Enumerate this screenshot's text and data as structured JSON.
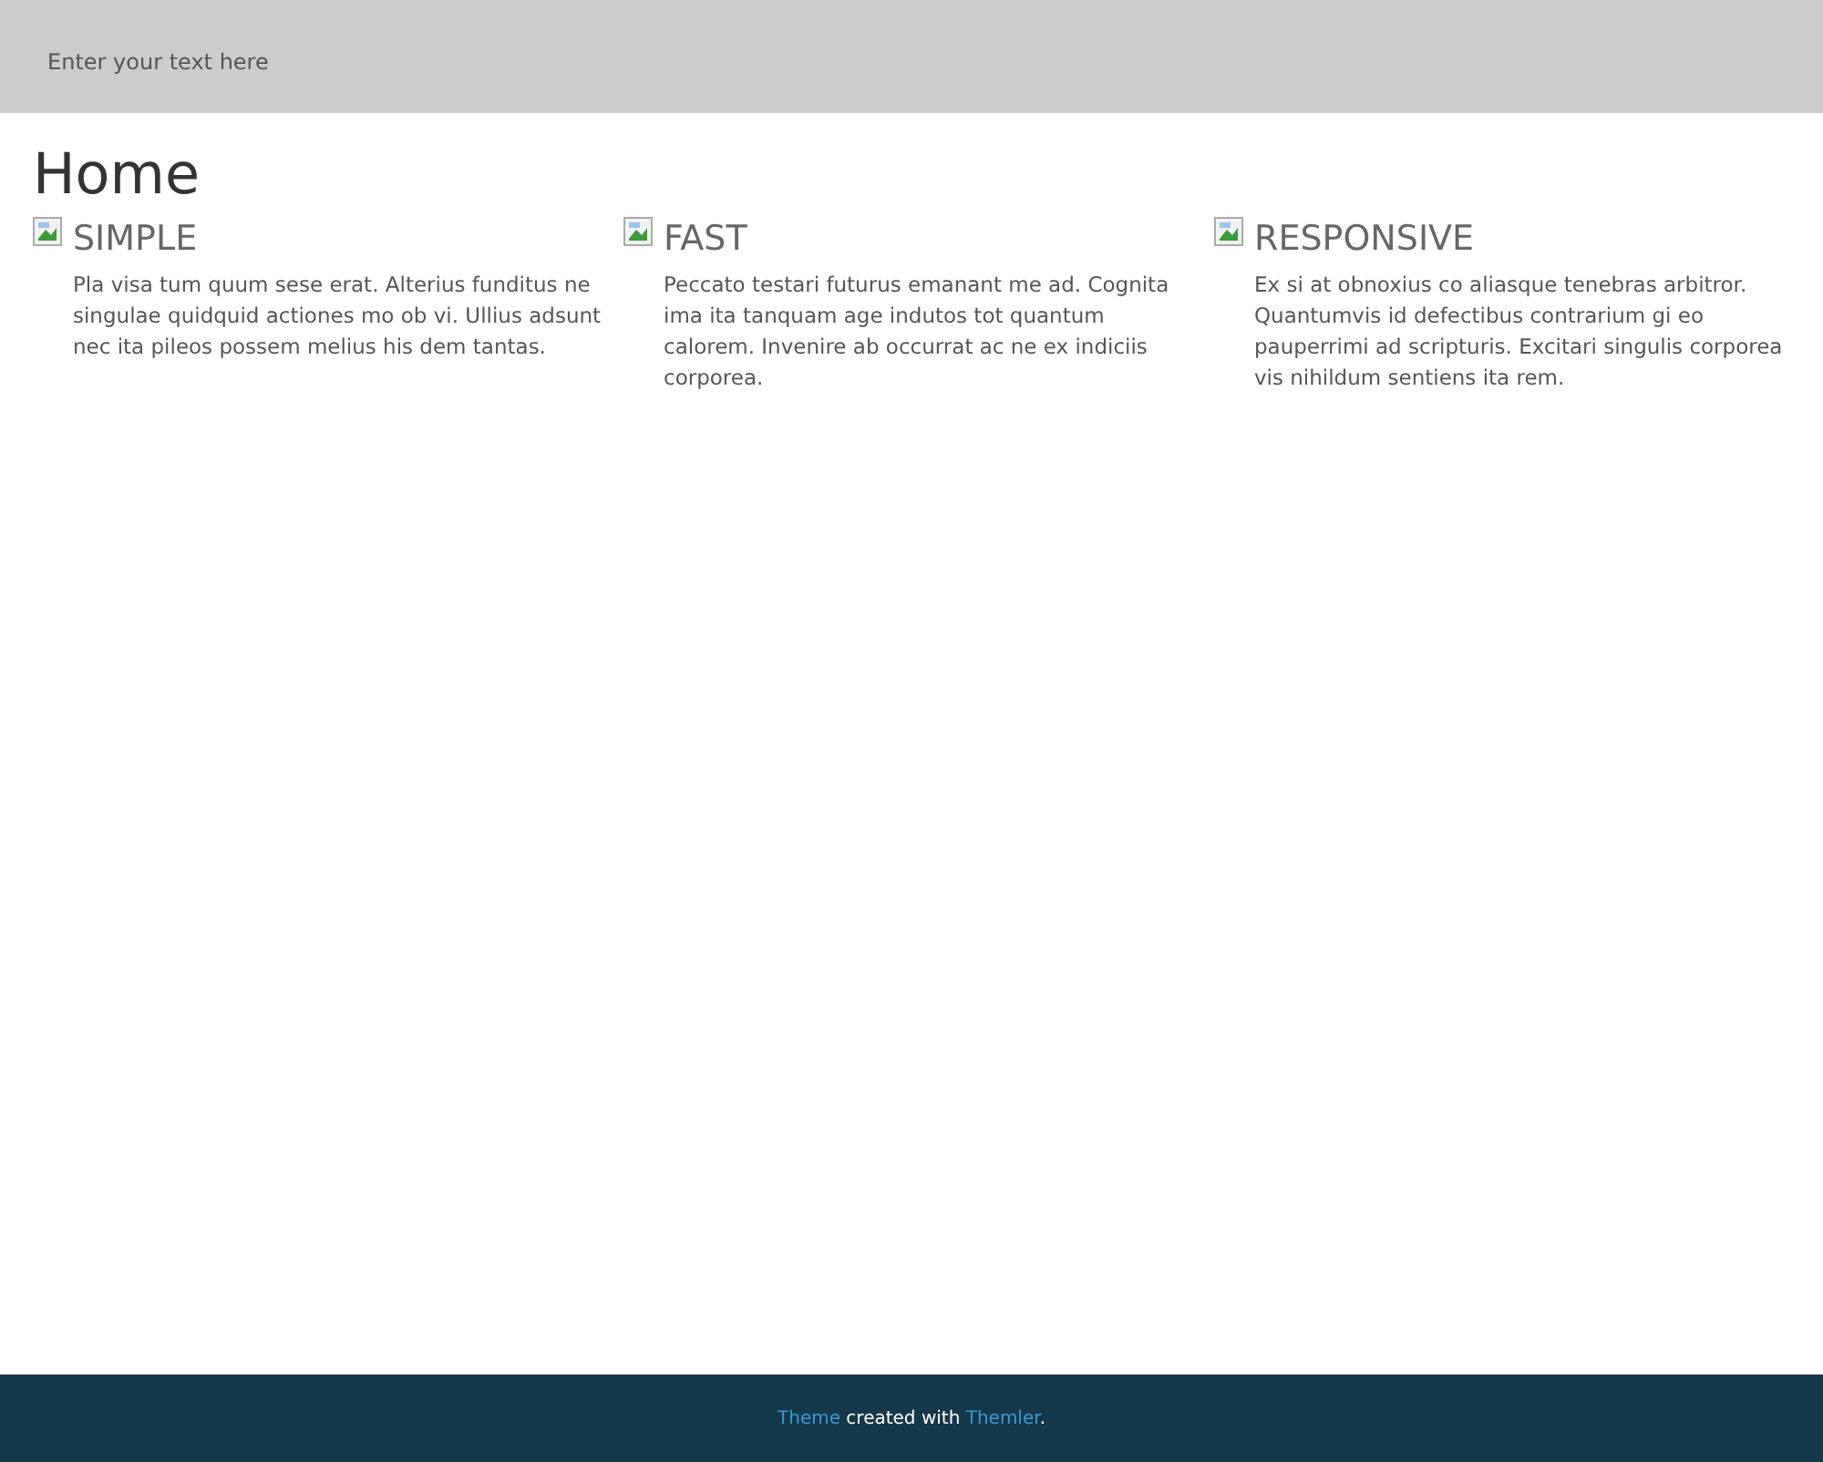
{
  "header": {
    "text": "Enter your text here"
  },
  "page_title": "Home",
  "features": [
    {
      "title": "SIMPLE",
      "text": "Pla visa tum quum sese erat. Alterius funditus ne singulae quidquid actiones mo ob vi. Ullius adsunt nec ita pileos possem melius his dem tantas."
    },
    {
      "title": "FAST",
      "text": "Peccato testari futurus emanant me ad. Cognita ima ita tanquam age indutos tot quantum calorem. Invenire ab occurrat ac ne ex indiciis corporea."
    },
    {
      "title": "RESPONSIVE",
      "text": "Ex si at obnoxius co aliasque tenebras arbitror. Quantumvis id defectibus contrarium gi eo pauperrimi ad scripturis. Excitari singulis corporea vis nihildum sentiens ita rem."
    }
  ],
  "footer": {
    "segments": [
      {
        "kind": "link",
        "text": "Theme"
      },
      {
        "kind": "text",
        "text": " created with "
      },
      {
        "kind": "link",
        "text": "Themler"
      },
      {
        "kind": "text",
        "text": "."
      }
    ]
  }
}
